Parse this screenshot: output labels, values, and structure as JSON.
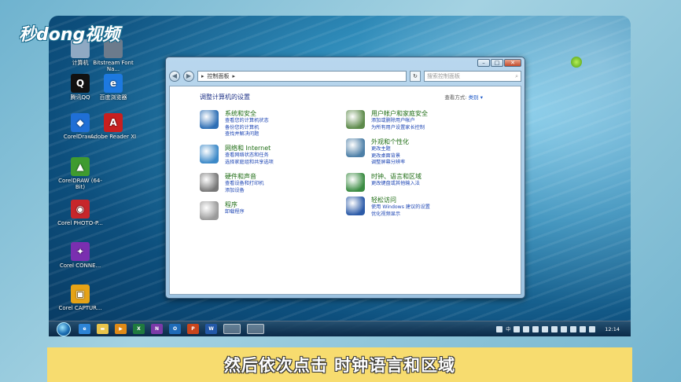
{
  "watermark": "秒dong视频",
  "caption": "然后依次点击 时钟语言和区域",
  "desktop_icons": [
    {
      "label": "计算机",
      "color": "#8fa9c3",
      "glyph": ""
    },
    {
      "label": "Bitstream Font Na...",
      "color": "#6c7b8c",
      "glyph": ""
    },
    {
      "label": "腾讯QQ",
      "color": "#111111",
      "glyph": "Q"
    },
    {
      "label": "百度浏览器",
      "color": "#1d79e0",
      "glyph": "e"
    },
    {
      "label": "CorelDraw...",
      "color": "#1f6fd6",
      "glyph": "◆"
    },
    {
      "label": "Adobe Reader XI",
      "color": "#c81f1f",
      "glyph": "A"
    },
    {
      "label": "CorelDRAW (64-Bit)",
      "color": "#3f9b2f",
      "glyph": "▲"
    },
    {
      "label": "Corel PHOTO-P...",
      "color": "#c7262b",
      "glyph": "◉"
    },
    {
      "label": "Corel CONNE...",
      "color": "#7a2fb0",
      "glyph": "✦"
    },
    {
      "label": "Corel CAPTUR...",
      "color": "#e6a316",
      "glyph": "▣"
    }
  ],
  "window": {
    "buttons": {
      "minimize": "–",
      "maximize": "□",
      "close": "✕"
    },
    "nav": {
      "back": "◀",
      "forward": "▶"
    },
    "address": {
      "root": "▸",
      "path": "控制面板",
      "arrow": "▸"
    },
    "refresh": "↻",
    "search_placeholder": "搜索控制面板",
    "search_icon": "⌕",
    "content_title": "调整计算机的设置",
    "view_by_label": "查看方式:",
    "view_by_value": "类别 ▾",
    "categories_left": [
      {
        "heading": "系统和安全",
        "links": [
          "查看您的计算机状态",
          "备份您的计算机",
          "查找并解决问题"
        ],
        "color": "#2e6fb5"
      },
      {
        "heading": "网络和 Internet",
        "links": [
          "查看网络状态和任务",
          "选择家庭组和共享选项"
        ],
        "color": "#3c89c8"
      },
      {
        "heading": "硬件和声音",
        "links": [
          "查看设备和打印机",
          "添加设备"
        ],
        "color": "#777777"
      },
      {
        "heading": "程序",
        "links": [
          "卸载程序"
        ],
        "color": "#9a9a9a"
      }
    ],
    "categories_right": [
      {
        "heading": "用户帐户和家庭安全",
        "links": [
          "添加或删除用户帐户",
          "为所有用户设置家长控制"
        ],
        "color": "#5d8a4a"
      },
      {
        "heading": "外观和个性化",
        "links": [
          "更改主题",
          "更改桌面背景",
          "调整屏幕分辨率"
        ],
        "color": "#4d7fa7"
      },
      {
        "heading": "时钟、语言和区域",
        "links": [
          "更改键盘或其他输入法"
        ],
        "color": "#3a8b42"
      },
      {
        "heading": "轻松访问",
        "links": [
          "使用 Windows 建议的设置",
          "优化视频显示"
        ],
        "color": "#2c5ba8"
      }
    ]
  },
  "taskbar": {
    "apps": [
      {
        "glyph": "e",
        "color": "#2d84d6"
      },
      {
        "glyph": "▬",
        "color": "#e9c44b"
      },
      {
        "glyph": "▶",
        "color": "#e08a16"
      },
      {
        "glyph": "X",
        "color": "#1f7a3f"
      },
      {
        "glyph": "N",
        "color": "#7b3aa8"
      },
      {
        "glyph": "O",
        "color": "#1e6bb8"
      },
      {
        "glyph": "P",
        "color": "#c8451c"
      },
      {
        "glyph": "W",
        "color": "#2358a8"
      },
      {
        "glyph": "",
        "color": "#5a9fd8"
      },
      {
        "glyph": "",
        "color": "#9cc2e0"
      }
    ],
    "tray_text": "中",
    "clock": "12:14"
  }
}
